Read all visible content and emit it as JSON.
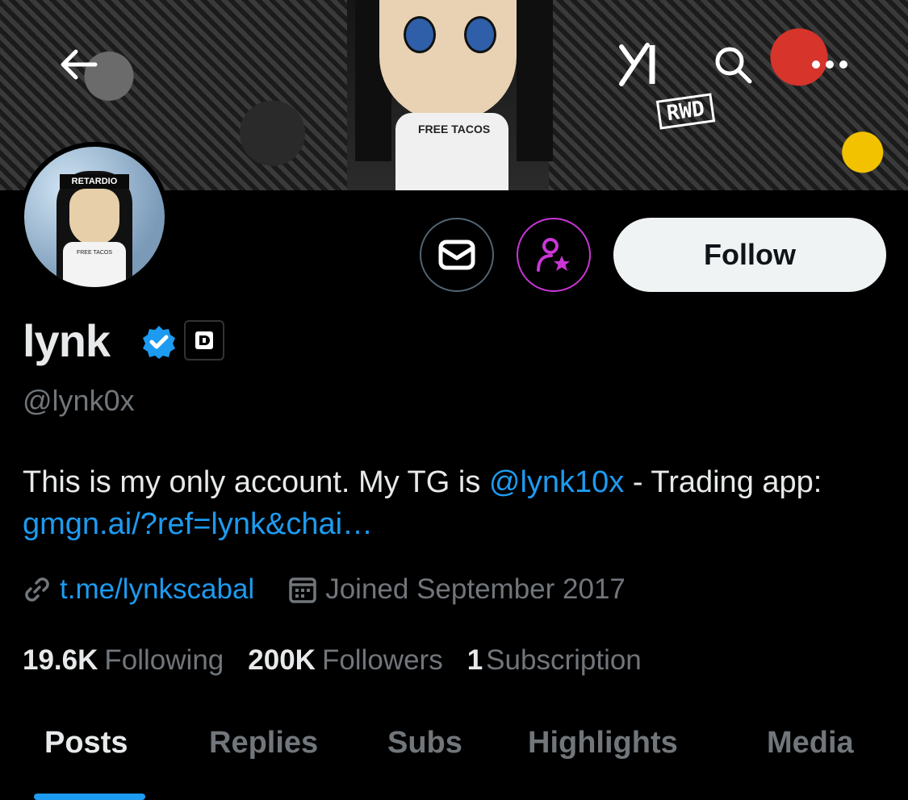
{
  "banner": {
    "shirt_text": "FREE TACOS",
    "art_text": "RWD"
  },
  "top_bar": {
    "back_icon": "arrow-left-icon",
    "grok_icon": "grok-icon",
    "search_icon": "search-icon",
    "more_icon": "more-horizontal-icon"
  },
  "avatar": {
    "band_text": "RETARDIO",
    "shirt_text": "FREE TACOS"
  },
  "actions": {
    "message_icon": "envelope-icon",
    "subscribe_icon": "user-star-icon",
    "follow_label": "Follow",
    "subscribe_color": "#c936d6"
  },
  "profile": {
    "display_name": "lynk",
    "handle": "@lynk0x",
    "verified_color": "#1d9bf0"
  },
  "bio": {
    "part1": "This is my only account. My TG is ",
    "mention": "@lynk10x",
    "part2": " - Trading app: ",
    "link": "gmgn.ai/?ref=lynk&chai…"
  },
  "meta": {
    "website": "t.me/lynkscabal",
    "joined": "Joined September 2017"
  },
  "stats": {
    "following_count": "19.6K",
    "following_label": "Following",
    "followers_count": "200K",
    "followers_label": "Followers",
    "subs_count": "1",
    "subs_label": "Subscription"
  },
  "tabs": {
    "posts": "Posts",
    "replies": "Replies",
    "subs": "Subs",
    "highlights": "Highlights",
    "media": "Media",
    "accent": "#1d9bf0"
  }
}
